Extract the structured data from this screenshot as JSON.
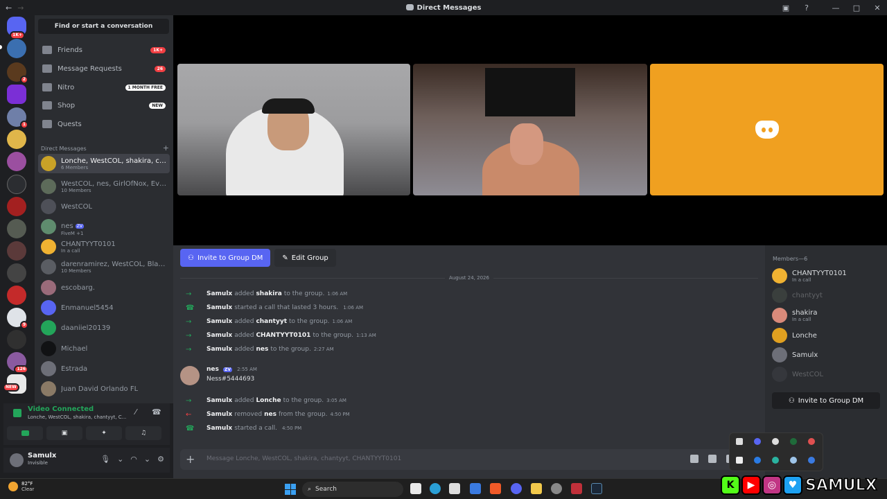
{
  "window": {
    "title": "Direct Messages"
  },
  "sidebar": {
    "search_label": "Find or start a conversation",
    "nav": [
      {
        "label": "Friends",
        "badge": "1K+"
      },
      {
        "label": "Message Requests",
        "badge": "26"
      },
      {
        "label": "Nitro",
        "badge": "1 MONTH FREE"
      },
      {
        "label": "Shop",
        "badge": "NEW"
      },
      {
        "label": "Quests",
        "badge": ""
      }
    ],
    "dm_header": "Direct Messages",
    "dms": [
      {
        "name": "Lonche, WestCOL, shakira, cha...",
        "sub": "6 Members",
        "color": "#c9a227",
        "active": true
      },
      {
        "name": "WestCOL, nes, GirlOfNox, Eva P...",
        "sub": "10 Members",
        "color": "#5d6b5a"
      },
      {
        "name": "WestCOL",
        "sub": "",
        "color": "#4e5058"
      },
      {
        "name": "nes",
        "sub": "FiveM +1",
        "color": "#5f8c6e",
        "tag": "ZV"
      },
      {
        "name": "CHANTYYT0101",
        "sub": "In a call",
        "color": "#f0b232"
      },
      {
        "name": "darenramirez, WestCOL, Blassti...",
        "sub": "10 Members",
        "color": "#5a5d63"
      },
      {
        "name": "escobarg.",
        "sub": "",
        "color": "#9a6b7a"
      },
      {
        "name": "Enmanuel5454",
        "sub": "",
        "color": "#5865f2"
      },
      {
        "name": "daaniiel20139",
        "sub": "",
        "color": "#23a55a"
      },
      {
        "name": "Michael",
        "sub": "",
        "color": "#111214"
      },
      {
        "name": "Estrada",
        "sub": "",
        "color": "#6d6f78"
      },
      {
        "name": "Juan David Orlando FL",
        "sub": "",
        "color": "#8a7a66"
      }
    ]
  },
  "rail": {
    "badge_top": "1K+",
    "badges": [
      "2",
      "1",
      "9",
      "126"
    ],
    "new_label": "NEW"
  },
  "voice": {
    "status": "Video Connected",
    "where": "Lonche, WestCOL, shakira, chantyyt, C..."
  },
  "user": {
    "name": "Samulx",
    "status": "Invisible"
  },
  "chat": {
    "invite_label": "Invite to Group DM",
    "edit_label": "Edit Group",
    "date": "August 24, 2026",
    "events": [
      {
        "actor": "Samulx",
        "verb": "added",
        "target": "shakira",
        "rest": "to the group.",
        "time": "1:06 AM",
        "kind": "add"
      },
      {
        "actor": "Samulx",
        "verb": "started a call that lasted 3 hours.",
        "target": "",
        "rest": "",
        "time": "1:06 AM",
        "kind": "call"
      },
      {
        "actor": "Samulx",
        "verb": "added",
        "target": "chantyyt",
        "rest": "to the group.",
        "time": "1:06 AM",
        "kind": "add"
      },
      {
        "actor": "Samulx",
        "verb": "added",
        "target": "CHANTYYT0101",
        "rest": "to the group.",
        "time": "1:13 AM",
        "kind": "add"
      },
      {
        "actor": "Samulx",
        "verb": "added",
        "target": "nes",
        "rest": "to the group.",
        "time": "2:27 AM",
        "kind": "add"
      }
    ],
    "message": {
      "author": "nes",
      "tag": "ZV",
      "time": "2:55 AM",
      "text": "Ness#5444693"
    },
    "events2": [
      {
        "actor": "Samulx",
        "verb": "added",
        "target": "Lonche",
        "rest": "to the group.",
        "time": "3:05 AM",
        "kind": "add"
      },
      {
        "actor": "Samulx",
        "verb": "removed",
        "target": "nes",
        "rest": "from the group.",
        "time": "4:50 PM",
        "kind": "remove"
      },
      {
        "actor": "Samulx",
        "verb": "started a call.",
        "target": "",
        "rest": "",
        "time": "4:50 PM",
        "kind": "call"
      }
    ],
    "placeholder": "Message Lonche, WestCOL, shakira, chantyyt, CHANTYYT0101"
  },
  "members": {
    "header": "Members—6",
    "list": [
      {
        "name": "CHANTYYT0101",
        "sub": "In a call",
        "color": "#f0b232",
        "dim": false
      },
      {
        "name": "chantyyt",
        "sub": "",
        "color": "#5d6b5a",
        "dim": true
      },
      {
        "name": "shakira",
        "sub": "In a call",
        "color": "#d98a7a",
        "dim": false
      },
      {
        "name": "Lonche",
        "sub": "",
        "color": "#e0a020",
        "dim": false
      },
      {
        "name": "Samulx",
        "sub": "",
        "color": "#6d6f78",
        "dim": false
      },
      {
        "name": "WestCOL",
        "sub": "",
        "color": "#4e5058",
        "dim": true
      }
    ],
    "invite_label": "Invite to Group DM"
  },
  "taskbar": {
    "temp": "82°F",
    "cond": "Clear",
    "search": "Search"
  },
  "overlay": {
    "handle": "SAMULX"
  }
}
